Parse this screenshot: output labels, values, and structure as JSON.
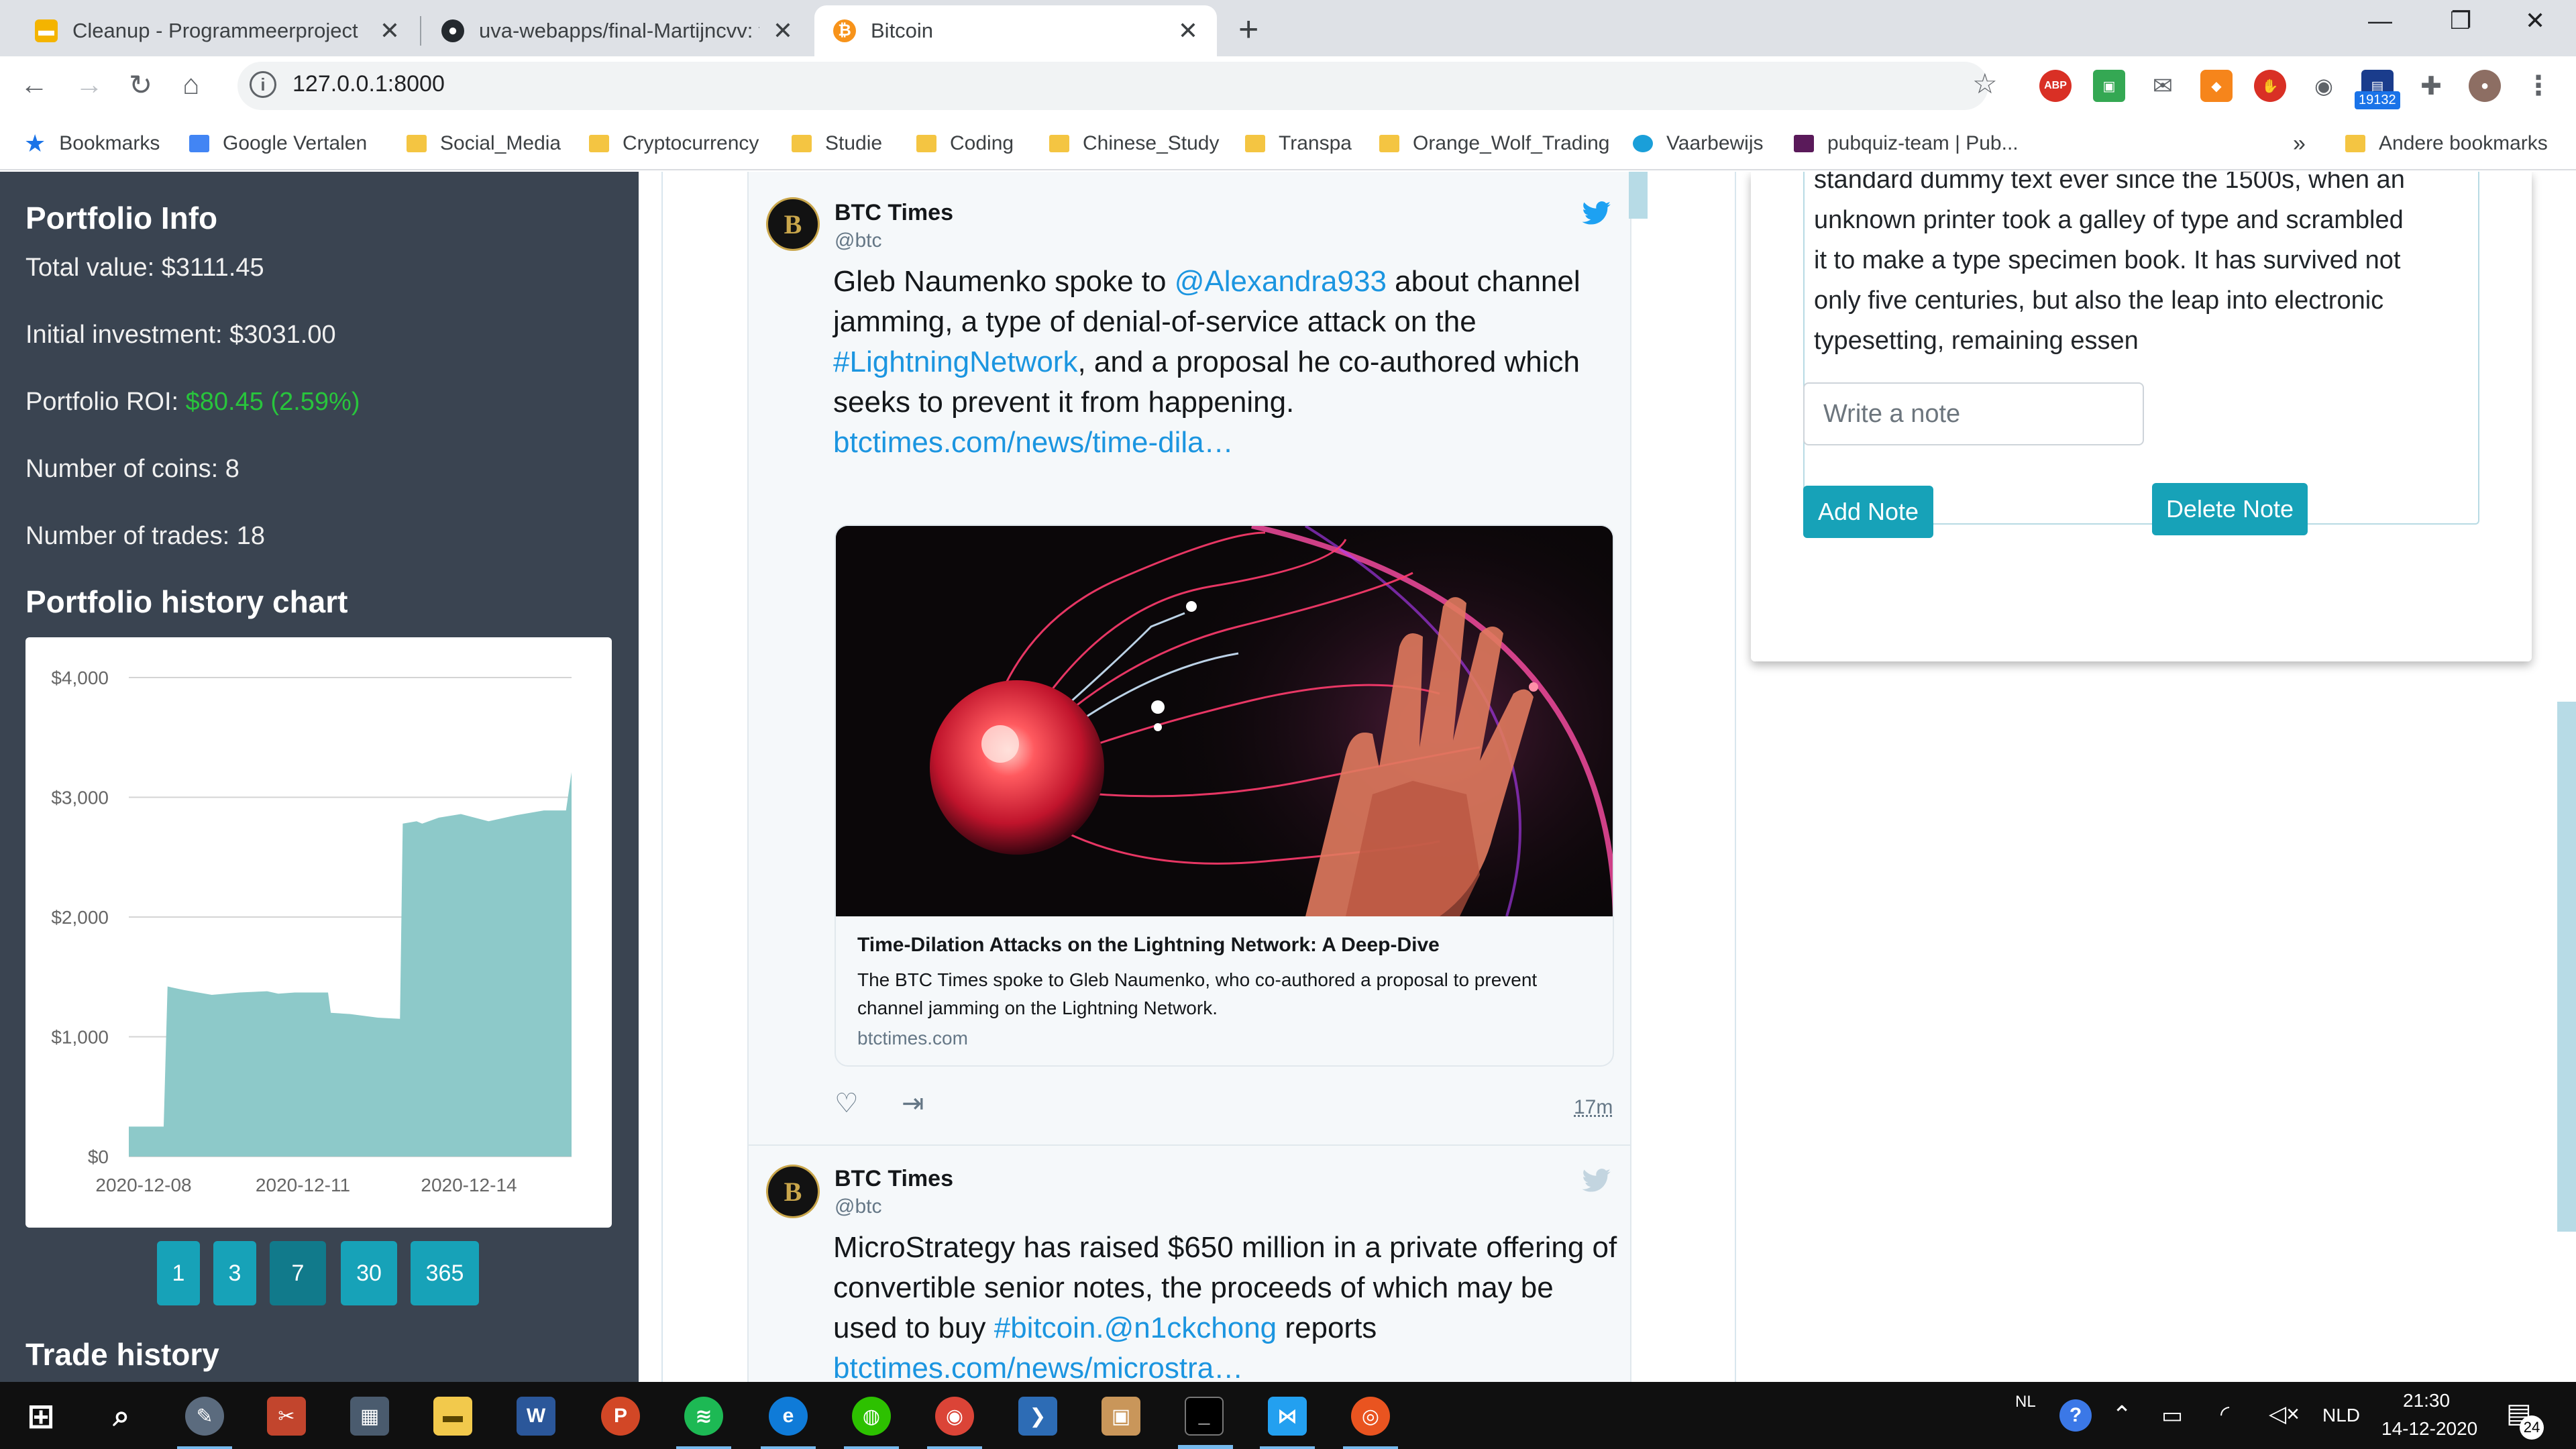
{
  "browser": {
    "tabs": [
      {
        "title": "Cleanup - Programmeerproject",
        "icon": "google-slides-icon",
        "active": false
      },
      {
        "title": "uva-webapps/final-Martijncvv: final-Martijncvv",
        "icon": "github-icon",
        "active": false
      },
      {
        "title": "Bitcoin",
        "icon": "bitcoin-icon",
        "active": true
      }
    ],
    "url": "127.0.0.1:8000",
    "extension_badge": "19132",
    "abp_label": "ABP",
    "overflow_label": "»",
    "bookmarks": [
      {
        "label": "Bookmarks",
        "icon": "star-icon"
      },
      {
        "label": "Google Vertalen",
        "icon": "google-translate-icon"
      },
      {
        "label": "Social_Media",
        "icon": "folder-icon"
      },
      {
        "label": "Cryptocurrency",
        "icon": "folder-icon"
      },
      {
        "label": "Studie",
        "icon": "folder-icon"
      },
      {
        "label": "Coding",
        "icon": "folder-icon"
      },
      {
        "label": "Chinese_Study",
        "icon": "folder-icon"
      },
      {
        "label": "Transpa",
        "icon": "folder-icon"
      },
      {
        "label": "Orange_Wolf_Trading",
        "icon": "folder-icon"
      },
      {
        "label": "Vaarbewijs",
        "icon": "compass-icon"
      },
      {
        "label": "pubquiz-team | Pub...",
        "icon": "pubquiz-icon"
      },
      {
        "label": "Andere bookmarks",
        "icon": "folder-icon"
      }
    ]
  },
  "portfolio": {
    "heading": "Portfolio Info",
    "total_value": "Total value: $3111.45",
    "initial_investment": "Initial investment: $3031.00",
    "roi_label": "Portfolio ROI: ",
    "roi_value": "$80.45 (2.59%)",
    "coins": "Number of coins: 8",
    "trades": "Number of trades: 18",
    "chart_heading": "Portfolio history chart",
    "range_buttons": [
      "1",
      "3",
      "7",
      "30",
      "365"
    ],
    "active_range": "7",
    "trade_history_heading": "Trade history",
    "accent_color": "#17a2b8",
    "roi_color": "#28c53c"
  },
  "chart_data": {
    "type": "area",
    "title": "",
    "xlabel": "",
    "ylabel": "",
    "ylim": [
      0,
      4000
    ],
    "yticks": [
      "$0",
      "$1,000",
      "$2,000",
      "$3,000",
      "$4,000"
    ],
    "xticks": [
      "2020-12-08",
      "2020-12-11",
      "2020-12-14"
    ],
    "color": "#8dc9c9",
    "x": [
      0,
      0.6,
      0.63,
      0.7,
      1.0,
      1.5,
      2.0,
      2.5,
      2.7,
      3.0,
      3.6,
      3.65,
      4.0,
      4.5,
      4.9,
      4.95,
      5.2,
      5.3,
      5.6,
      6.0,
      6.5,
      7.0,
      7.5,
      7.9,
      8.0
    ],
    "values": [
      250,
      250,
      250,
      1420,
      1390,
      1350,
      1370,
      1380,
      1360,
      1370,
      1370,
      1200,
      1190,
      1160,
      1150,
      2780,
      2800,
      2780,
      2830,
      2860,
      2800,
      2850,
      2890,
      2890,
      3210
    ]
  },
  "tweets": [
    {
      "name": "BTC Times",
      "handle": "@btc",
      "avatar_letter": "B",
      "text_parts": [
        "Gleb Naumenko spoke to ",
        "@Alexandra933",
        " about channel jamming, a type of denial-of-service attack on the ",
        "#LightningNetwork",
        ", and a proposal he co-authored which seeks to prevent it from happening. ",
        "btctimes.com/news/time-dila…"
      ],
      "card": {
        "title": "Time-Dilation Attacks on the Lightning Network: A Deep-Dive",
        "description": "The BTC Times spoke to Gleb Naumenko, who co-authored a proposal to prevent channel jamming on the Lightning Network.",
        "domain": "btctimes.com"
      },
      "time": "17m"
    },
    {
      "name": "BTC Times",
      "handle": "@btc",
      "avatar_letter": "B",
      "text_parts": [
        "MicroStrategy has raised $650 million in a private offering of convertible senior notes, the proceeds of which may be used to buy ",
        "#bitcoin",
        ".",
        "@n1ckchong",
        " reports ",
        "btctimes.com/news/microstra…"
      ]
    }
  ],
  "notes": {
    "lines": [
      "standard dummy text ever since the 1500s, when an",
      "unknown printer took a galley of type and scrambled",
      "it to make a type specimen book. It has survived not",
      "only five centuries, but also the leap into electronic",
      "typesetting, remaining essen"
    ],
    "input_placeholder": "Write a note",
    "add_label": "Add Note",
    "delete_label": "Delete Note"
  },
  "taskbar": {
    "language_small": "NL",
    "language": "NLD",
    "time": "21:30",
    "date": "14-12-2020",
    "notification_count": "24"
  }
}
